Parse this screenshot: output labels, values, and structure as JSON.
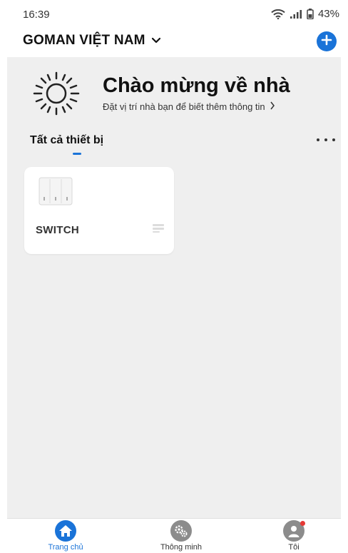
{
  "status_bar": {
    "time": "16:39",
    "battery": "43%"
  },
  "header": {
    "home_name": "GOMAN VIỆT NAM",
    "add_icon": "plus-circle-icon"
  },
  "welcome": {
    "title": "Chào mừng về nhà",
    "subtitle": "Đặt vị trí nhà bạn để biết thêm thông tin",
    "icon": "sun-icon"
  },
  "tabs": {
    "all_devices": "Tất cả thiết bị",
    "more_icon": "more-horizontal-icon"
  },
  "devices": [
    {
      "name": "SWITCH",
      "icon": "wall-switch-icon"
    }
  ],
  "bottom_nav": {
    "items": [
      {
        "label": "Trang chủ",
        "icon": "home-icon",
        "active": true
      },
      {
        "label": "Thông minh",
        "icon": "gears-icon",
        "active": false
      },
      {
        "label": "Tôi",
        "icon": "user-icon",
        "active": false
      }
    ]
  },
  "colors": {
    "accent": "#1a73d8",
    "background": "#efefef",
    "badge": "#e53935"
  }
}
